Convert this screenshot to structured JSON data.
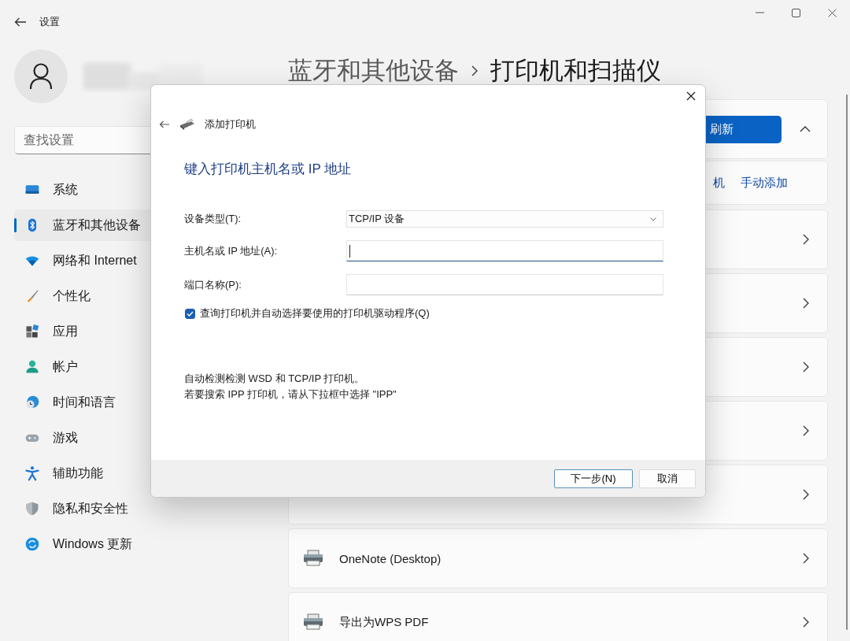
{
  "window": {
    "title": "设置"
  },
  "search": {
    "placeholder": "查找设置"
  },
  "nav": [
    {
      "label": "系统",
      "selected": false
    },
    {
      "label": "蓝牙和其他设备",
      "selected": true
    },
    {
      "label": "网络和 Internet",
      "selected": false
    },
    {
      "label": "个性化",
      "selected": false
    },
    {
      "label": "应用",
      "selected": false
    },
    {
      "label": "帐户",
      "selected": false
    },
    {
      "label": "时间和语言",
      "selected": false
    },
    {
      "label": "游戏",
      "selected": false
    },
    {
      "label": "辅助功能",
      "selected": false
    },
    {
      "label": "隐私和安全性",
      "selected": false
    },
    {
      "label": "Windows 更新",
      "selected": false
    }
  ],
  "breadcrumb": [
    "蓝牙和其他设备",
    "打印机和扫描仪"
  ],
  "add_card": {
    "button": "刷新",
    "expanded": true,
    "links": [
      "机",
      "手动添加"
    ]
  },
  "printers": [
    {
      "kind": "covered"
    },
    {
      "kind": "covered"
    },
    {
      "kind": "covered"
    },
    {
      "kind": "covered"
    },
    {
      "kind": "covered"
    },
    {
      "kind": "printer",
      "name": "OneNote (Desktop)"
    },
    {
      "kind": "printer",
      "name": "导出为WPS PDF"
    }
  ],
  "dialog": {
    "title": "添加打印机",
    "heading": "键入打印机主机名或 IP 地址",
    "fields": [
      {
        "kind": "select",
        "label": "设备类型(T):",
        "value": "TCP/IP 设备"
      },
      {
        "kind": "text",
        "label": "主机名或 IP 地址(A):",
        "focused": true
      },
      {
        "kind": "text",
        "label": "端口名称(P):",
        "focused": false
      }
    ],
    "checkbox": {
      "label": "查询打印机并自动选择要使用的打印机驱动程序(Q)",
      "checked": true
    },
    "description": [
      "自动检测检测 WSD 和 TCP/IP 打印机。",
      "若要搜索 IPP 打印机，请从下拉框中选择 \"IPP\""
    ],
    "buttons": [
      {
        "label": "下一步(N)",
        "default": true
      },
      {
        "label": "取消",
        "default": false
      }
    ]
  }
}
